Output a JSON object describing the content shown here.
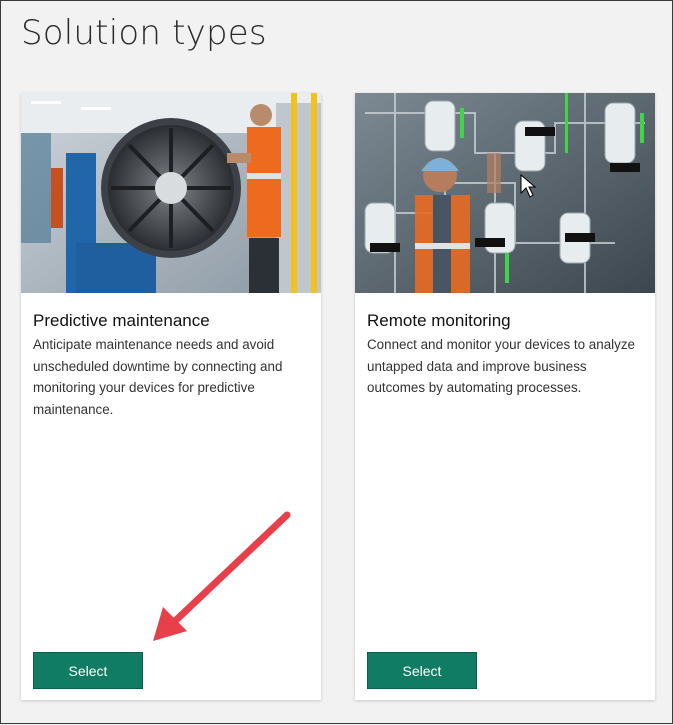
{
  "page": {
    "title": "Solution types"
  },
  "cards": [
    {
      "title": "Predictive maintenance",
      "description": "Anticipate maintenance needs and avoid unscheduled downtime by connecting and monitoring your devices for predictive maintenance.",
      "button_label": "Select",
      "image_icon": "jet-engine-technician-photo"
    },
    {
      "title": "Remote monitoring",
      "description": "Connect and monitor your devices to analyze untapped data and improve business outcomes by automating processes.",
      "button_label": "Select",
      "image_icon": "industrial-control-panel-photo"
    }
  ],
  "colors": {
    "button": "#107c63",
    "annotation_arrow": "#e8404a",
    "background": "#f2f2f2"
  }
}
